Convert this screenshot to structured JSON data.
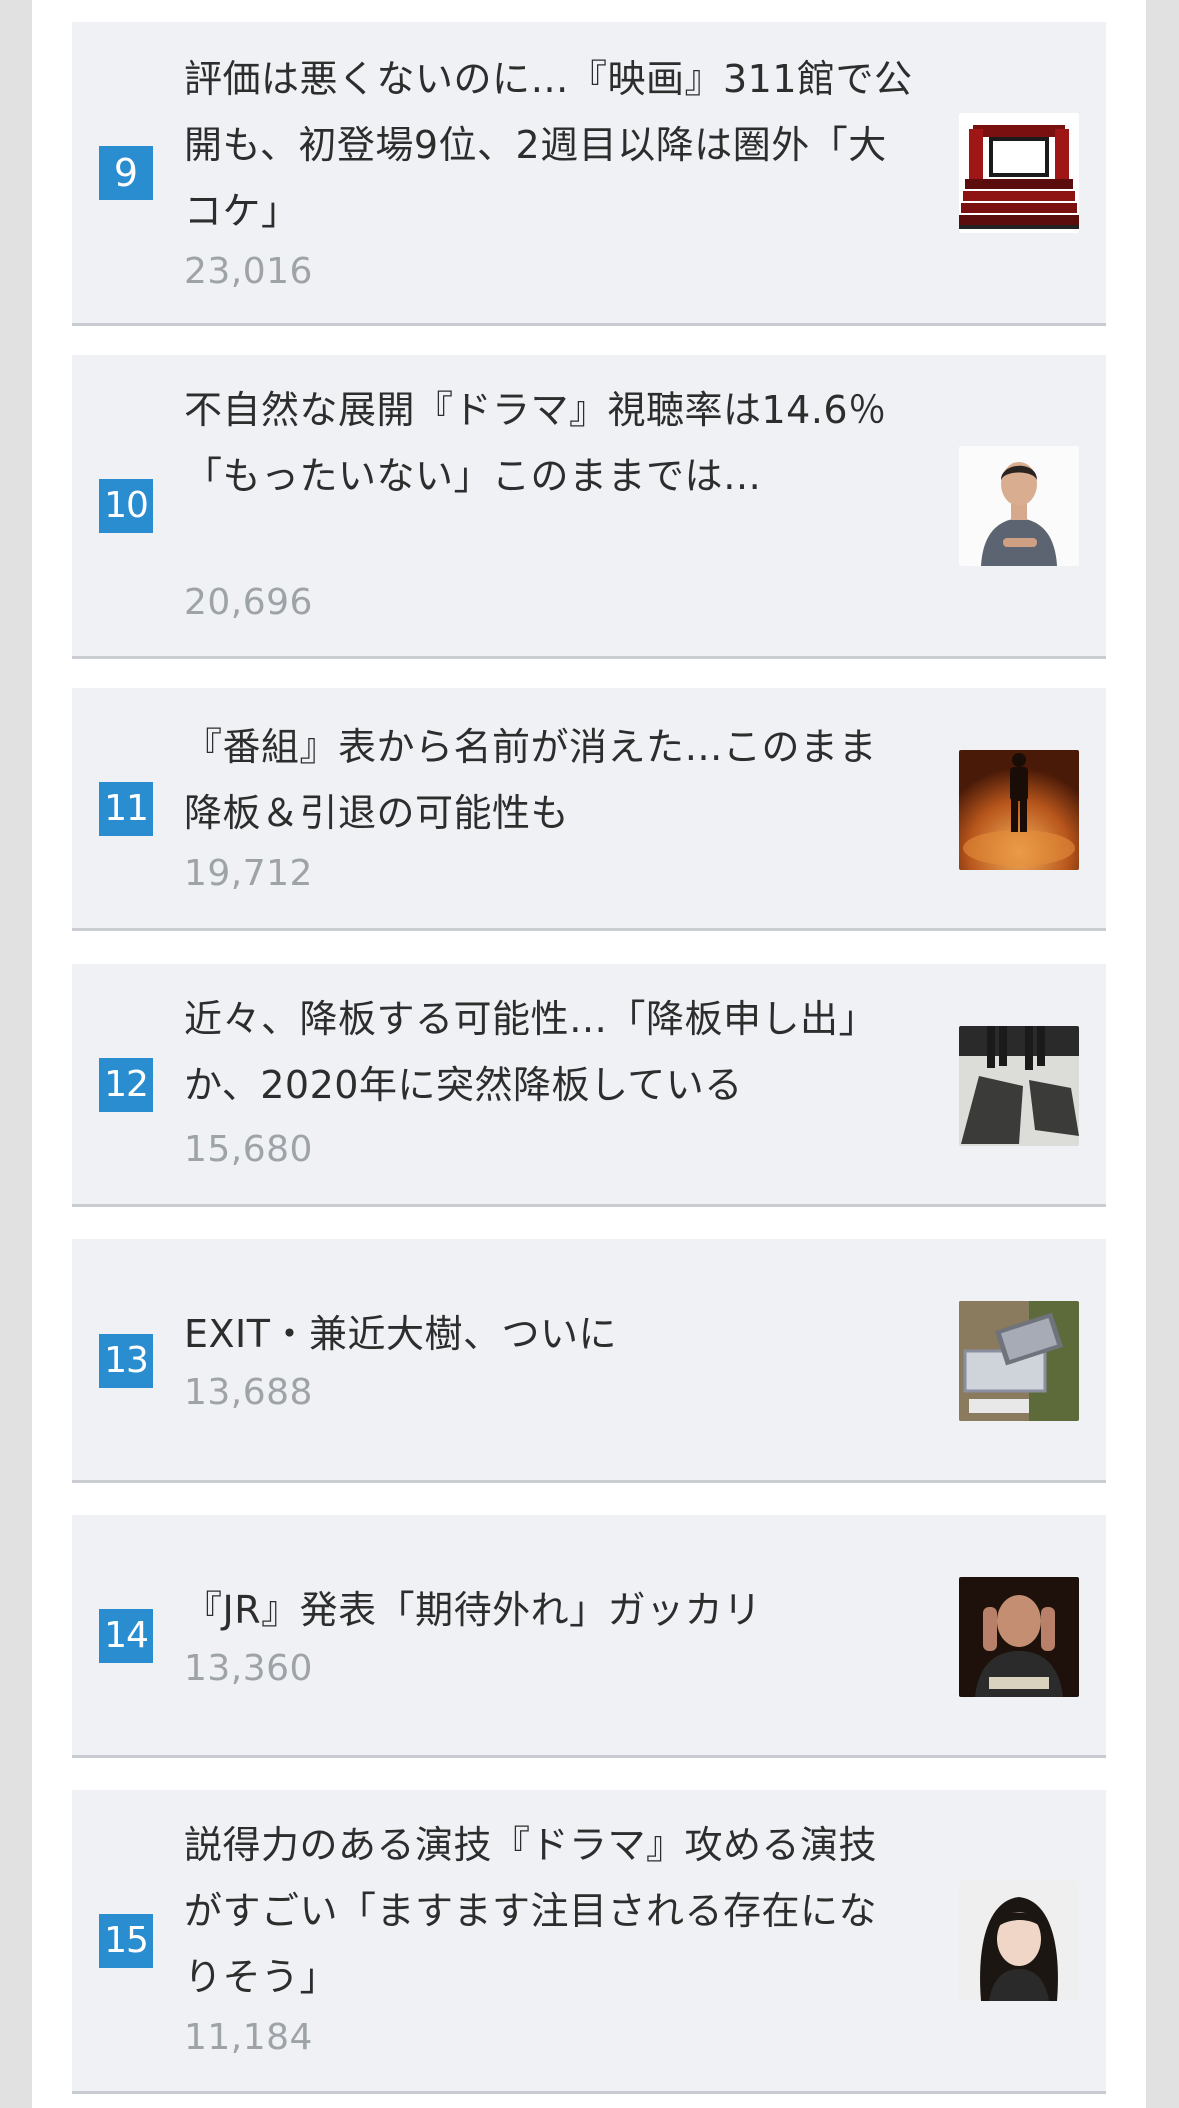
{
  "ranking": {
    "items": [
      {
        "rank": "9",
        "title": "評価は悪くないのに…『映画』311館で公開も、初登場9位、2週目以降は圏外「大コケ」",
        "views": "23,016",
        "thumbnail_icon": "movie-theater-icon"
      },
      {
        "rank": "10",
        "title": "不自然な展開『ドラマ』視聴率は14.6％「もったいない」このままでは…",
        "views": "20,696",
        "thumbnail_icon": "man-portrait-icon"
      },
      {
        "rank": "11",
        "title": "『番組』表から名前が消えた…このまま降板＆引退の可能性も",
        "views": "19,712",
        "thumbnail_icon": "silhouette-figure-icon"
      },
      {
        "rank": "12",
        "title": "近々、降板する可能性…「降板申し出」か、2020年に突然降板している",
        "views": "15,680",
        "thumbnail_icon": "walking-shadows-icon"
      },
      {
        "rank": "13",
        "title": "EXIT・兼近大樹、ついに",
        "views": "13,688",
        "thumbnail_icon": "laptop-on-lap-icon"
      },
      {
        "rank": "14",
        "title": "『JR』発表「期待外れ」ガッカリ",
        "views": "13,360",
        "thumbnail_icon": "man-head-in-hands-icon"
      },
      {
        "rank": "15",
        "title": "説得力のある演技『ドラマ』攻める演技がすごい「ますます注目される存在になりそう」",
        "views": "11,184",
        "thumbnail_icon": "woman-portrait-icon"
      }
    ]
  },
  "colors": {
    "rank_badge": "#2a8dd0",
    "card_background": "#eff1f4",
    "title_text": "#2d2d2d",
    "count_text": "#9ea3a8"
  }
}
